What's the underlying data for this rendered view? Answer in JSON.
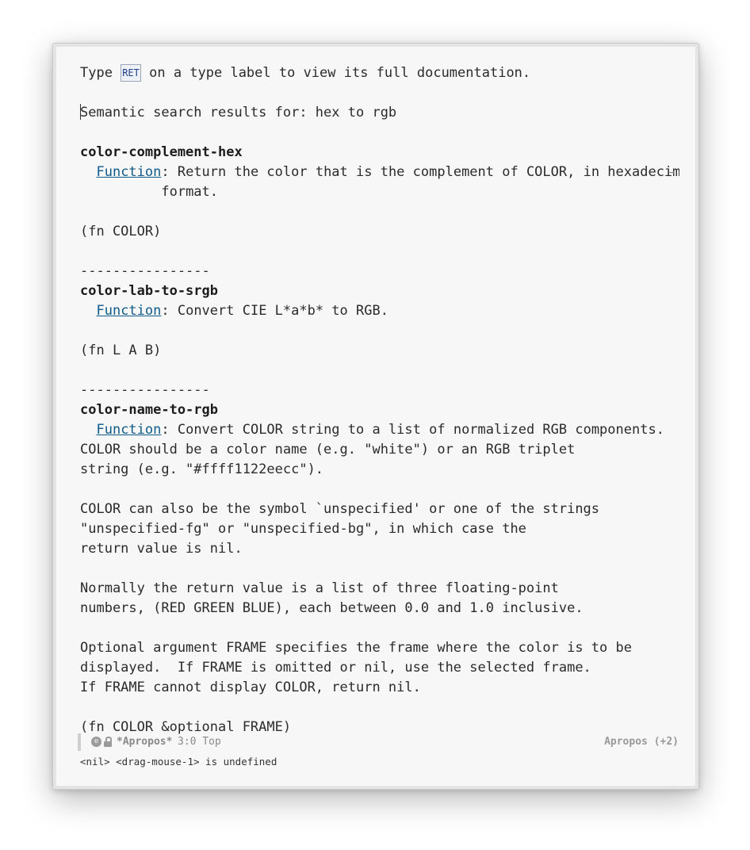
{
  "buffer": {
    "intro_pre": "Type ",
    "intro_key": "RET",
    "intro_post": " on a type label to view its full documentation.",
    "search_heading": "Semantic search results for: hex to rgb",
    "results": [
      {
        "name": "color-complement-hex",
        "type_label": "Function",
        "doc_first": ": Return the color that is the complement of COLOR, in hexadecima",
        "doc_cont": "format.",
        "signature": "(fn COLOR)"
      },
      {
        "name": "color-lab-to-srgb",
        "type_label": "Function",
        "doc_first": ": Convert CIE L*a*b* to RGB.",
        "signature": "(fn L A B)"
      },
      {
        "name": "color-name-to-rgb",
        "type_label": "Function",
        "doc_first": ": Convert COLOR string to a list of normalized RGB components.",
        "doc_lines": [
          "COLOR should be a color name (e.g. \"white\") or an RGB triplet",
          "string (e.g. \"#ffff1122eecc\").",
          "",
          "COLOR can also be the symbol `unspecified' or one of the strings",
          "\"unspecified-fg\" or \"unspecified-bg\", in which case the",
          "return value is nil.",
          "",
          "Normally the return value is a list of three floating-point",
          "numbers, (RED GREEN BLUE), each between 0.0 and 1.0 inclusive.",
          "",
          "Optional argument FRAME specifies the frame where the color is to be",
          "displayed.  If FRAME is omitted or nil, use the selected frame.",
          "If FRAME cannot display COLOR, return nil."
        ],
        "signature": "(fn COLOR &optional FRAME)"
      }
    ],
    "separator": "----------------",
    "truncation_glyph": "→"
  },
  "modeline": {
    "icon_left": "emacs-icon",
    "icon_lock": "lock-icon",
    "buffer_name": "*Apropos*",
    "position": "3:0 Top",
    "major_mode": "Apropos (+2)"
  },
  "echo_area": {
    "message": "<nil> <drag-mouse-1> is undefined"
  }
}
